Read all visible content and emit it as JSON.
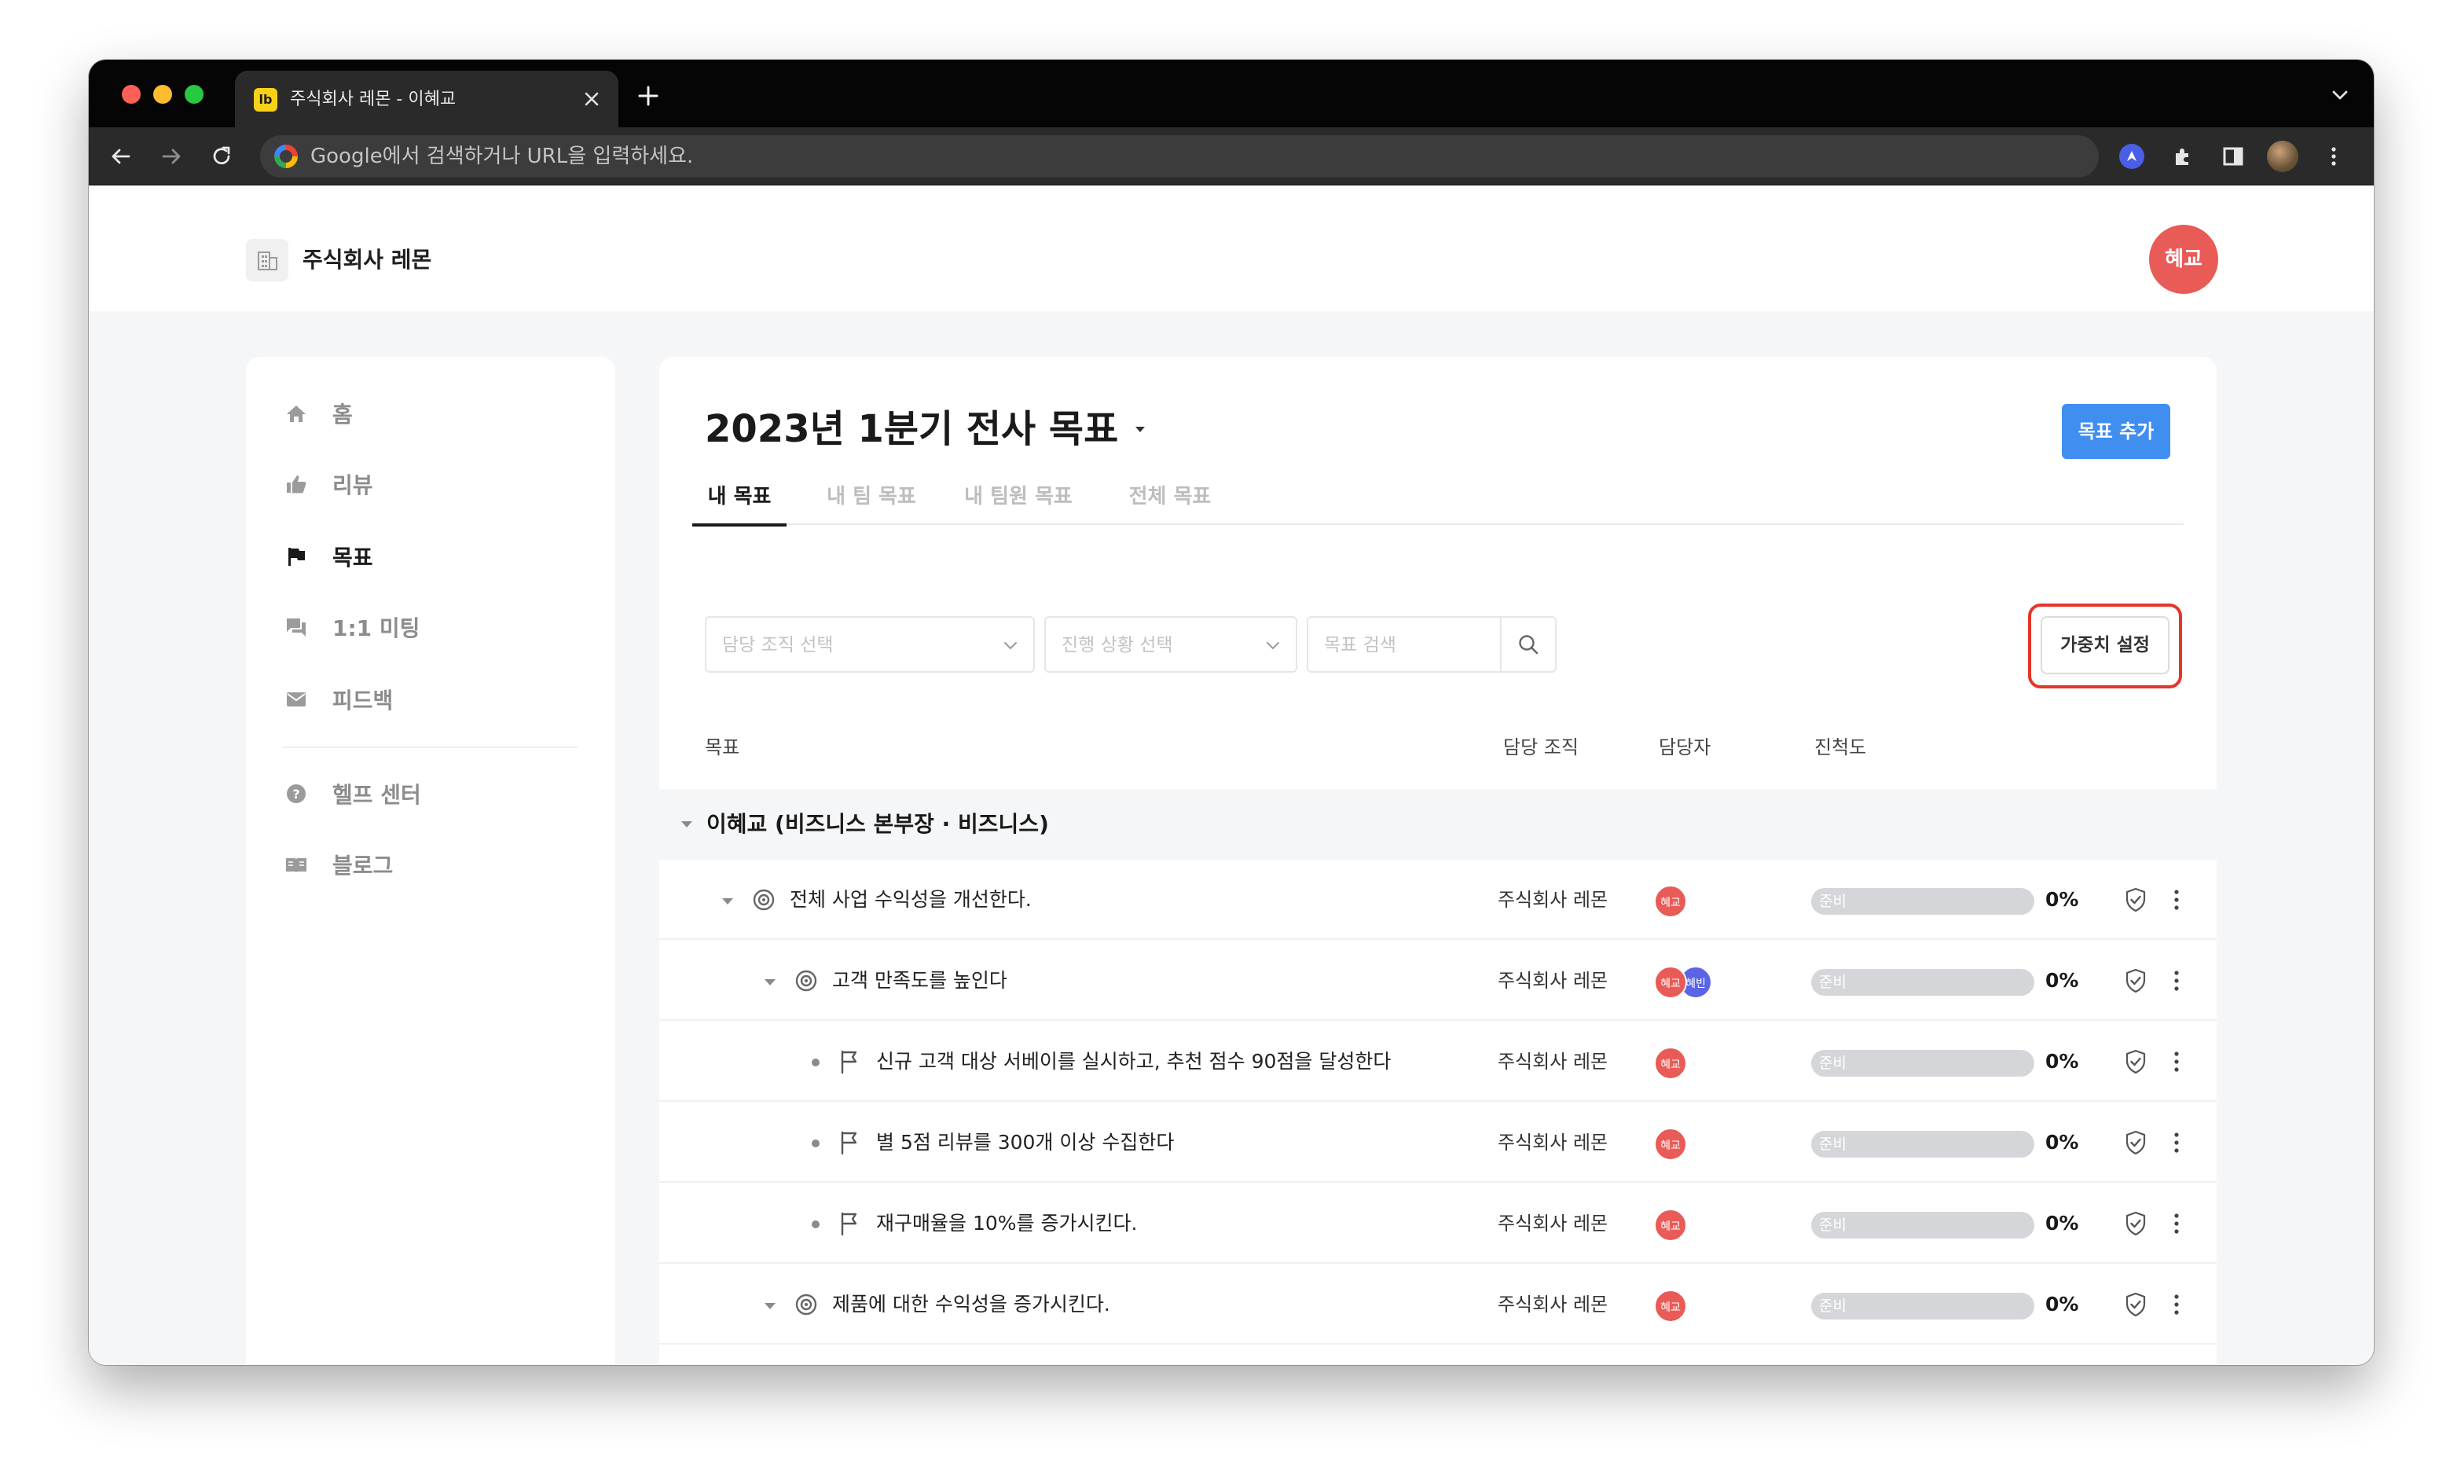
{
  "browser": {
    "tab_title": "주식회사 레몬 - 이혜교",
    "tab_favicon": "lb",
    "address_placeholder": "Google에서 검색하거나 URL을 입력하세요."
  },
  "header": {
    "company_name": "주식회사 레몬",
    "user_avatar": "혜교"
  },
  "sidebar": {
    "items": [
      {
        "label": "홈",
        "icon": "home-icon"
      },
      {
        "label": "리뷰",
        "icon": "thumbs-up-icon"
      },
      {
        "label": "목표",
        "icon": "flag-icon"
      },
      {
        "label": "1:1 미팅",
        "icon": "chat-icon"
      },
      {
        "label": "피드백",
        "icon": "mail-icon"
      },
      {
        "label": "헬프 센터",
        "icon": "help-icon"
      },
      {
        "label": "블로그",
        "icon": "book-icon"
      }
    ],
    "active": "목표"
  },
  "main": {
    "title": "2023년 1분기 전사 목표",
    "add_button": "목표 추가",
    "tabs": [
      "내 목표",
      "내 팀 목표",
      "내 팀원 목표",
      "전체 목표"
    ],
    "active_tab": "내 목표",
    "filters": {
      "org_placeholder": "담당 조직 선택",
      "status_placeholder": "진행 상황 선택",
      "search_placeholder": "목표 검색"
    },
    "weight_button": "가중치 설정",
    "columns": {
      "goal": "목표",
      "org": "담당 조직",
      "owner": "담당자",
      "progress": "진척도"
    },
    "group": {
      "label": "이혜교 (비즈니스 본부장 · 비즈니스)"
    },
    "rows": [
      {
        "text": "전체 사업 수익성을 개선한다.",
        "org": "주식회사 레몬",
        "owners": [
          "혜교"
        ],
        "status": "준비",
        "progress": 0,
        "percent_label": "0%",
        "level": 1,
        "kind": "objective"
      },
      {
        "text": "고객 만족도를 높인다",
        "org": "주식회사 레몬",
        "owners": [
          "혜교",
          "혜빈"
        ],
        "status": "준비",
        "progress": 0,
        "percent_label": "0%",
        "level": 2,
        "kind": "objective"
      },
      {
        "text": "신규 고객 대상 서베이를 실시하고, 추천 점수 90점을 달성한다",
        "org": "주식회사 레몬",
        "owners": [
          "혜교"
        ],
        "status": "준비",
        "progress": 0,
        "percent_label": "0%",
        "level": 3,
        "kind": "key-result"
      },
      {
        "text": "별 5점 리뷰를 300개 이상 수집한다",
        "org": "주식회사 레몬",
        "owners": [
          "혜교"
        ],
        "status": "준비",
        "progress": 0,
        "percent_label": "0%",
        "level": 3,
        "kind": "key-result"
      },
      {
        "text": "재구매율을 10%를 증가시킨다.",
        "org": "주식회사 레몬",
        "owners": [
          "혜교"
        ],
        "status": "준비",
        "progress": 0,
        "percent_label": "0%",
        "level": 3,
        "kind": "key-result"
      },
      {
        "text": "제품에 대한 수익성을 증가시킨다.",
        "org": "주식회사 레몬",
        "owners": [
          "혜교"
        ],
        "status": "준비",
        "progress": 0,
        "percent_label": "0%",
        "level": 2,
        "kind": "objective"
      }
    ]
  },
  "colors": {
    "accent": "#3f8ef0",
    "avatar_red": "#e85b57",
    "avatar_blue": "#5b64e6",
    "highlight_red": "#e5352b",
    "progress_track": "#d4d6d9"
  }
}
